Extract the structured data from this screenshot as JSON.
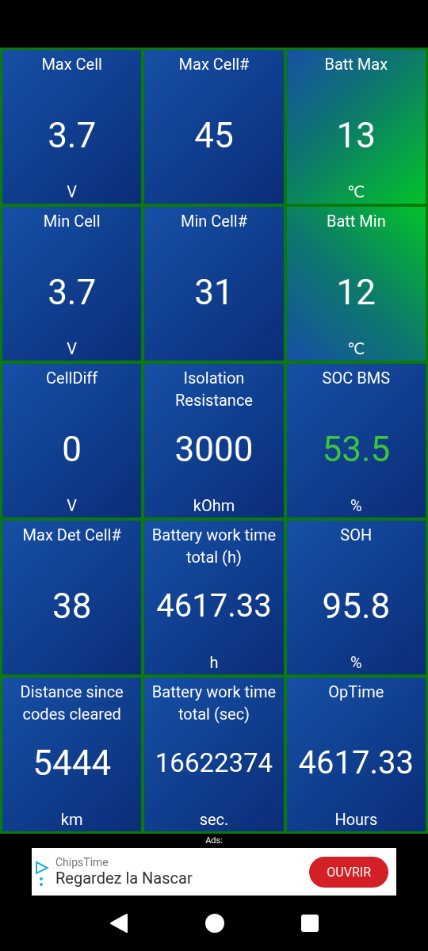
{
  "tiles": [
    {
      "title": "Max Cell",
      "value": "3.7",
      "unit": "V",
      "kind": "plain",
      "color": "#ffffff"
    },
    {
      "title": "Max Cell#",
      "value": "45",
      "kind": "plain",
      "color": "#ffffff"
    },
    {
      "title": "Batt Max",
      "value": "13",
      "unit": "℃",
      "kind": "green-bottom",
      "color": "#ffffff"
    },
    {
      "title": "Min Cell",
      "value": "3.7",
      "unit": "V",
      "kind": "plain",
      "color": "#ffffff"
    },
    {
      "title": "Min Cell#",
      "value": "31",
      "kind": "plain",
      "color": "#ffffff"
    },
    {
      "title": "Batt Min",
      "value": "12",
      "unit": "℃",
      "kind": "green-top",
      "color": "#ffffff"
    },
    {
      "title": "CellDiff",
      "value": "0",
      "unit": "V",
      "kind": "plain",
      "color": "#ffffff"
    },
    {
      "title": "Isolation Resistance",
      "value": "3000",
      "unit": "kOhm",
      "kind": "plain",
      "color": "#ffffff"
    },
    {
      "title": "SOC BMS",
      "value": "53.5",
      "unit": "%",
      "kind": "plain",
      "color": "#3cc43c"
    },
    {
      "title": "Max Det Cell#",
      "value": "38",
      "kind": "plain",
      "color": "#ffffff"
    },
    {
      "title": "Battery work time total (h)",
      "value": "4617.33",
      "unit": "h",
      "kind": "plain",
      "color": "#ffffff"
    },
    {
      "title": "SOH",
      "value": "95.8",
      "unit": "%",
      "kind": "plain",
      "color": "#ffffff"
    },
    {
      "title": "Distance since codes cleared",
      "value": "5444",
      "unit": "km",
      "kind": "plain",
      "color": "#ffffff"
    },
    {
      "title": "Battery work time total (sec)",
      "value": "16622374",
      "unit": "sec.",
      "kind": "plain",
      "color": "#ffffff"
    },
    {
      "title": "OpTime",
      "value": "4617.33",
      "unit": "Hours",
      "kind": "plain",
      "color": "#ffffff"
    }
  ],
  "ads": {
    "label": "Ads:",
    "advertiser": "ChipsTime",
    "headline": "Regardez la Nascar",
    "button": "OUVRIR"
  }
}
